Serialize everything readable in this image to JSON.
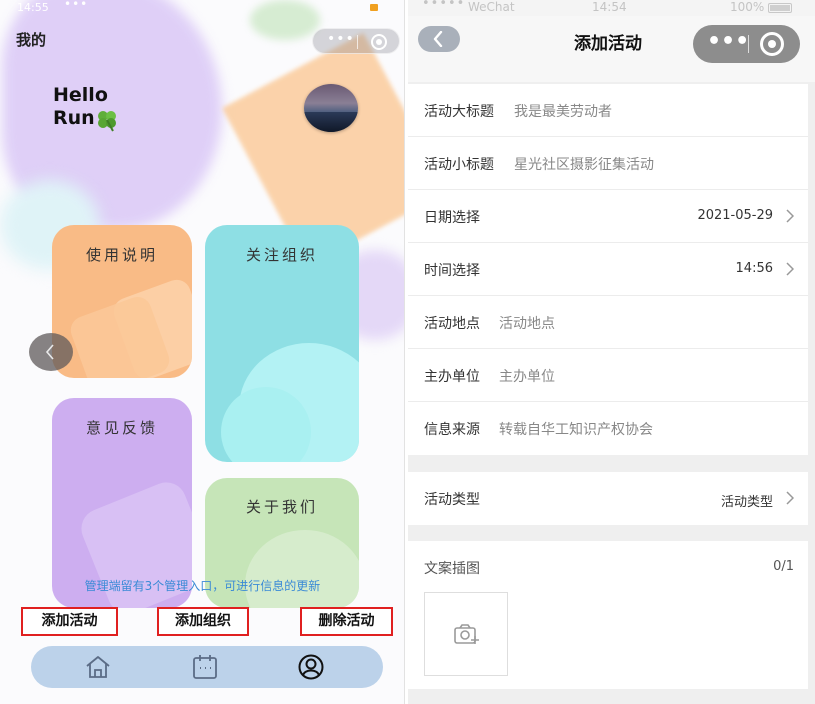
{
  "left": {
    "status": {
      "time": "14:55",
      "dots": "•••"
    },
    "title": "我的",
    "hello_line1": "Hello",
    "hello_line2": "Run",
    "cards": {
      "usage": "使用说明",
      "follow": "关注组织",
      "feedback": "意见反馈",
      "about": "关于我们"
    },
    "admin_note": "管理端留有3个管理入口，可进行信息的更新",
    "actions": {
      "add_activity": "添加活动",
      "add_org": "添加组织",
      "delete_activity": "删除活动"
    },
    "tabs": [
      "home-icon",
      "calendar-icon",
      "user-icon"
    ],
    "colors": {
      "orange_card": "#f9bb86",
      "teal_card": "#8edfe4",
      "purple_card": "#cdaef0",
      "green_card": "#c6e5b8",
      "highlight_border": "#e02020",
      "note_text": "#3a8ad6",
      "tabbar": "#bcd2ea"
    }
  },
  "right": {
    "status": {
      "dots": "•••••",
      "carrier": "WeChat",
      "time": "14:54",
      "battery": "100%"
    },
    "nav_title": "添加活动",
    "fields": [
      {
        "label": "活动大标题",
        "value": "我是最美劳动者"
      },
      {
        "label": "活动小标题",
        "value": "星光社区摄影征集活动"
      },
      {
        "label": "日期选择",
        "value": "2021-05-29"
      },
      {
        "label": "时间选择",
        "value": "14:56"
      },
      {
        "label": "活动地点",
        "value": "活动地点"
      },
      {
        "label": "主办单位",
        "value": "主办单位"
      },
      {
        "label": "信息来源",
        "value": "转载自华工知识产权协会"
      }
    ],
    "type_row": {
      "label": "活动类型",
      "value": "活动类型"
    },
    "upload": {
      "label": "文案插图",
      "count": "0/1"
    }
  }
}
